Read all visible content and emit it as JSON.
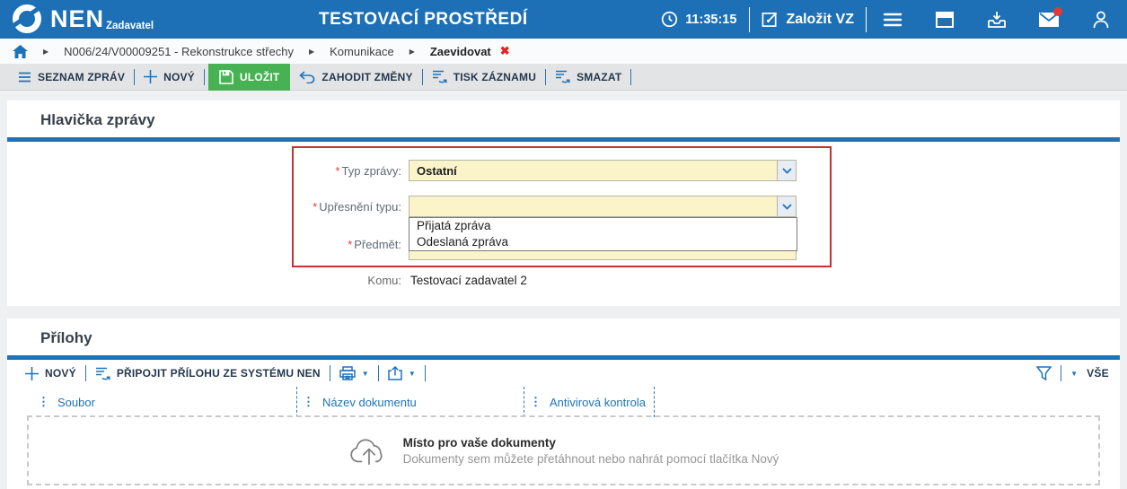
{
  "header": {
    "logo": "NEN",
    "logo_sub": "Zadavatel",
    "title": "TESTOVACÍ PROSTŘEDÍ",
    "time": "11:35:15",
    "create_vz_label": "Založit VZ"
  },
  "breadcrumb": {
    "items": [
      "N006/24/V00009251 - Rekonstrukce střechy",
      "Komunikace",
      "Zaevidovat"
    ],
    "separator": "▶",
    "close": "✖"
  },
  "toolbar": {
    "seznam_zprav": "SEZNAM ZPRÁV",
    "novy": "NOVÝ",
    "ulozit": "ULOŽIT",
    "zahodit_zmeny": "ZAHODIT ZMĚNY",
    "tisk_zaznamu": "TISK ZÁZNAMU",
    "smazat": "SMAZAT"
  },
  "message_header": {
    "title": "Hlavička zprávy",
    "required_marker": "*",
    "typ_label": "Typ zprávy:",
    "typ_value": "Ostatní",
    "upresneni_label": "Upřesnění typu:",
    "upresneni_value": "",
    "predmet_label": "Předmět:",
    "predmet_value": "",
    "komu_label": "Komu:",
    "komu_value": "Testovací zadavatel 2",
    "dropdown_options": [
      "Přijatá zpráva",
      "Odeslaná zpráva"
    ]
  },
  "attachments": {
    "title": "Přílohy",
    "novy": "NOVÝ",
    "pripojit": "PŘIPOJIT PŘÍLOHU ZE SYSTÉMU NEN",
    "vse": "VŠE",
    "columns": [
      "Soubor",
      "Název dokumentu",
      "Antivirová kontrola"
    ],
    "kebab": "⋮",
    "caret": "▼",
    "dropzone_title": "Místo pro vaše dokumenty",
    "dropzone_subtitle": "Dokumenty sem můžete přetáhnout nebo nahrát pomocí tlačítka Nový"
  },
  "colors": {
    "header_blue": "#1d70b5",
    "accent_blue": "#1e73b8",
    "save_green": "#47b254",
    "field_yellow": "#fbf4c9",
    "required_red": "#c4342f",
    "notification_red": "#e53935"
  }
}
